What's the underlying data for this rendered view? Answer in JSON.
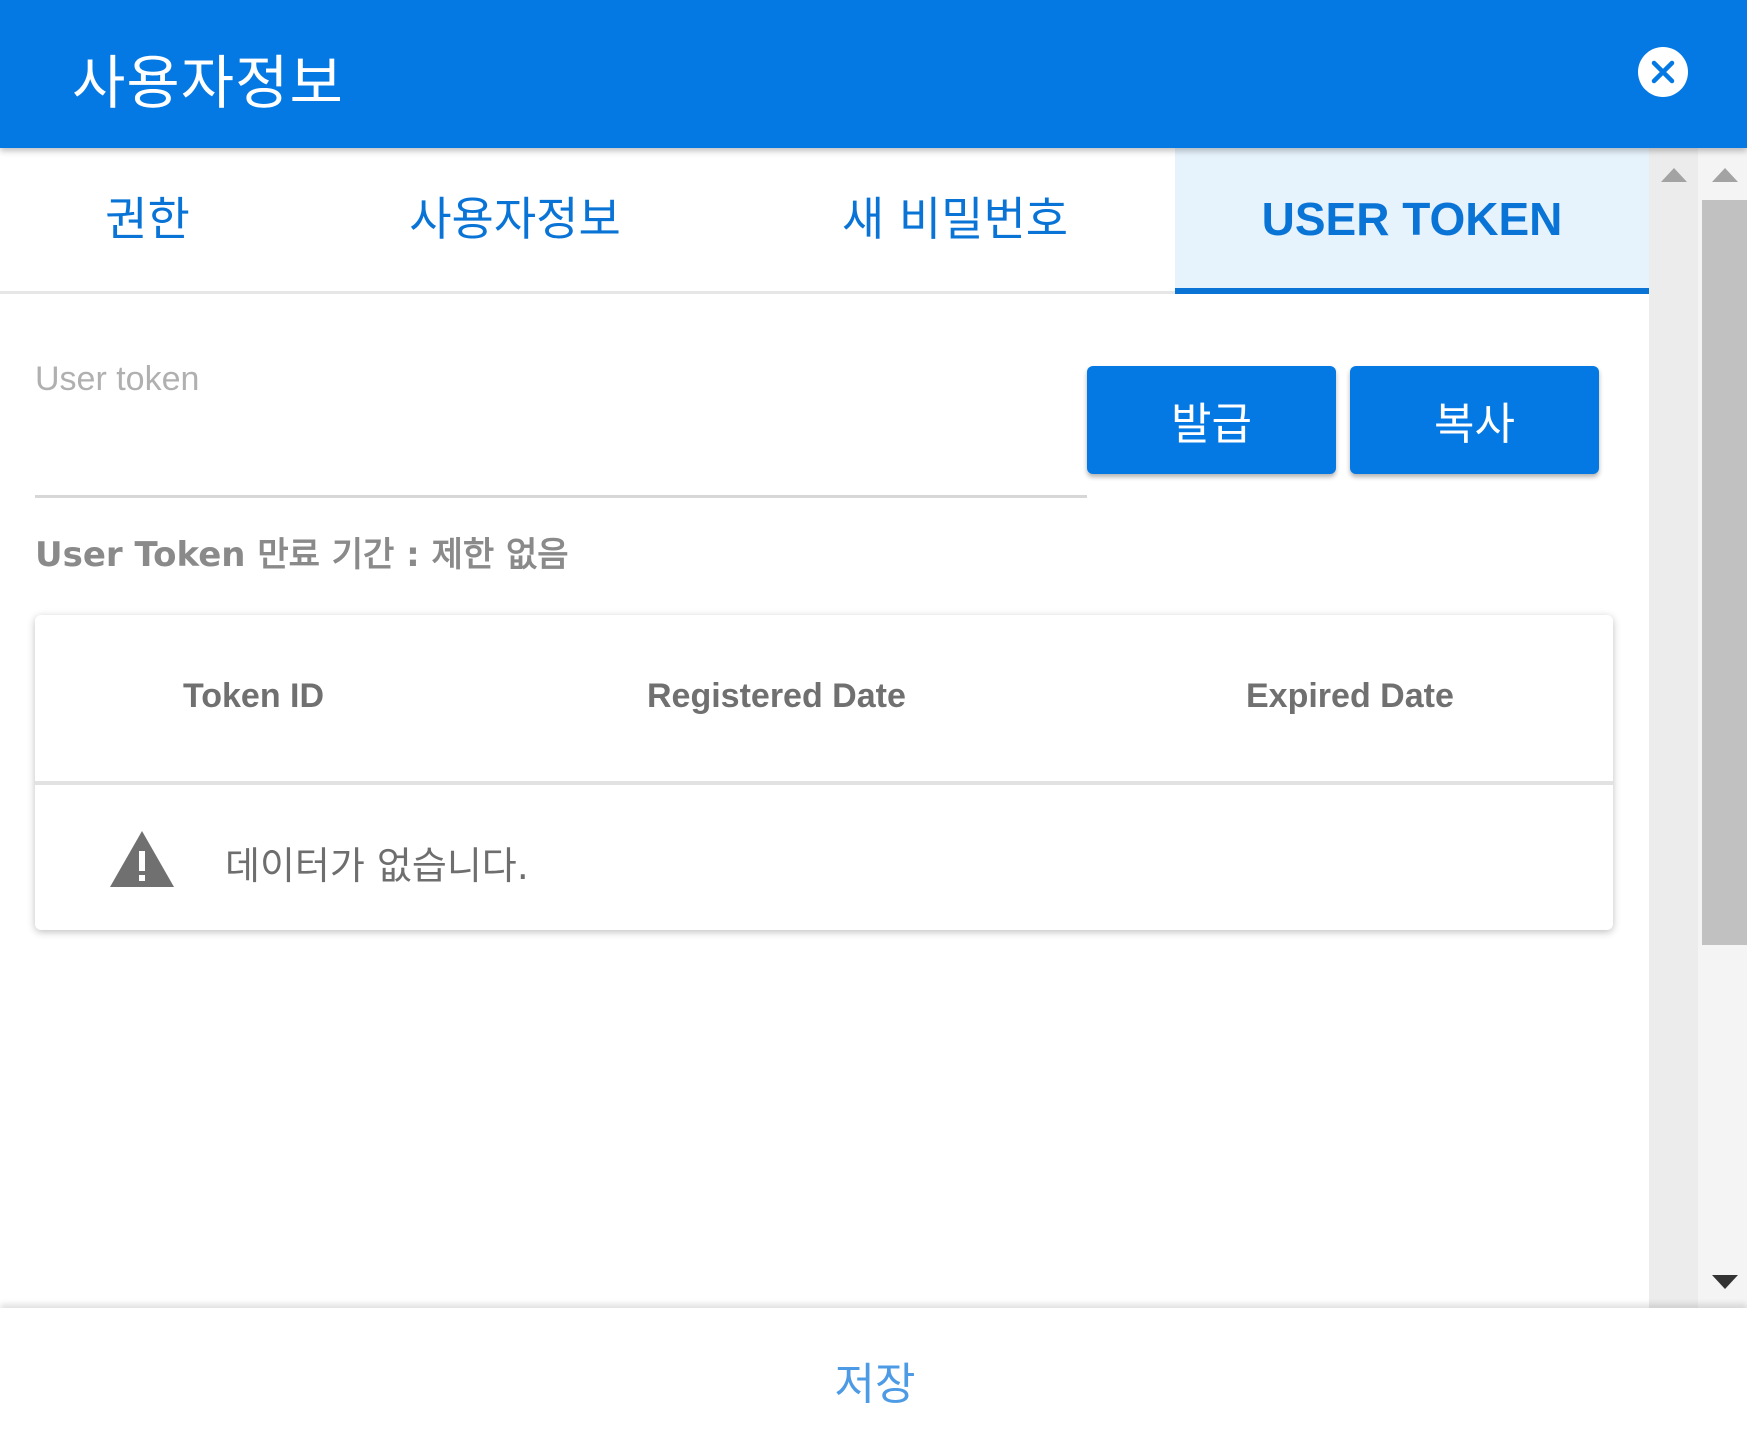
{
  "dialog": {
    "title": "사용자정보"
  },
  "tabs": [
    {
      "label": "권한",
      "active": false
    },
    {
      "label": "사용자정보",
      "active": false
    },
    {
      "label": "새 비밀번호",
      "active": false
    },
    {
      "label": "USER TOKEN",
      "active": true
    }
  ],
  "token": {
    "field_label": "User token",
    "value": "",
    "issue_label": "발급",
    "copy_label": "복사",
    "expiry_text": "User Token 만료 기간 : 제한 없음"
  },
  "table": {
    "columns": [
      "Token ID",
      "Registered Date",
      "Expired Date"
    ],
    "rows": [],
    "empty_text": "데이터가 없습니다."
  },
  "footer": {
    "save_label": "저장"
  },
  "colors": {
    "primary": "#0579e3",
    "tab_text": "#0a74d6",
    "active_tab_bg": "#e6f2fc"
  },
  "icons": [
    "close-icon",
    "warning-icon",
    "scroll-up-icon",
    "scroll-down-icon"
  ]
}
